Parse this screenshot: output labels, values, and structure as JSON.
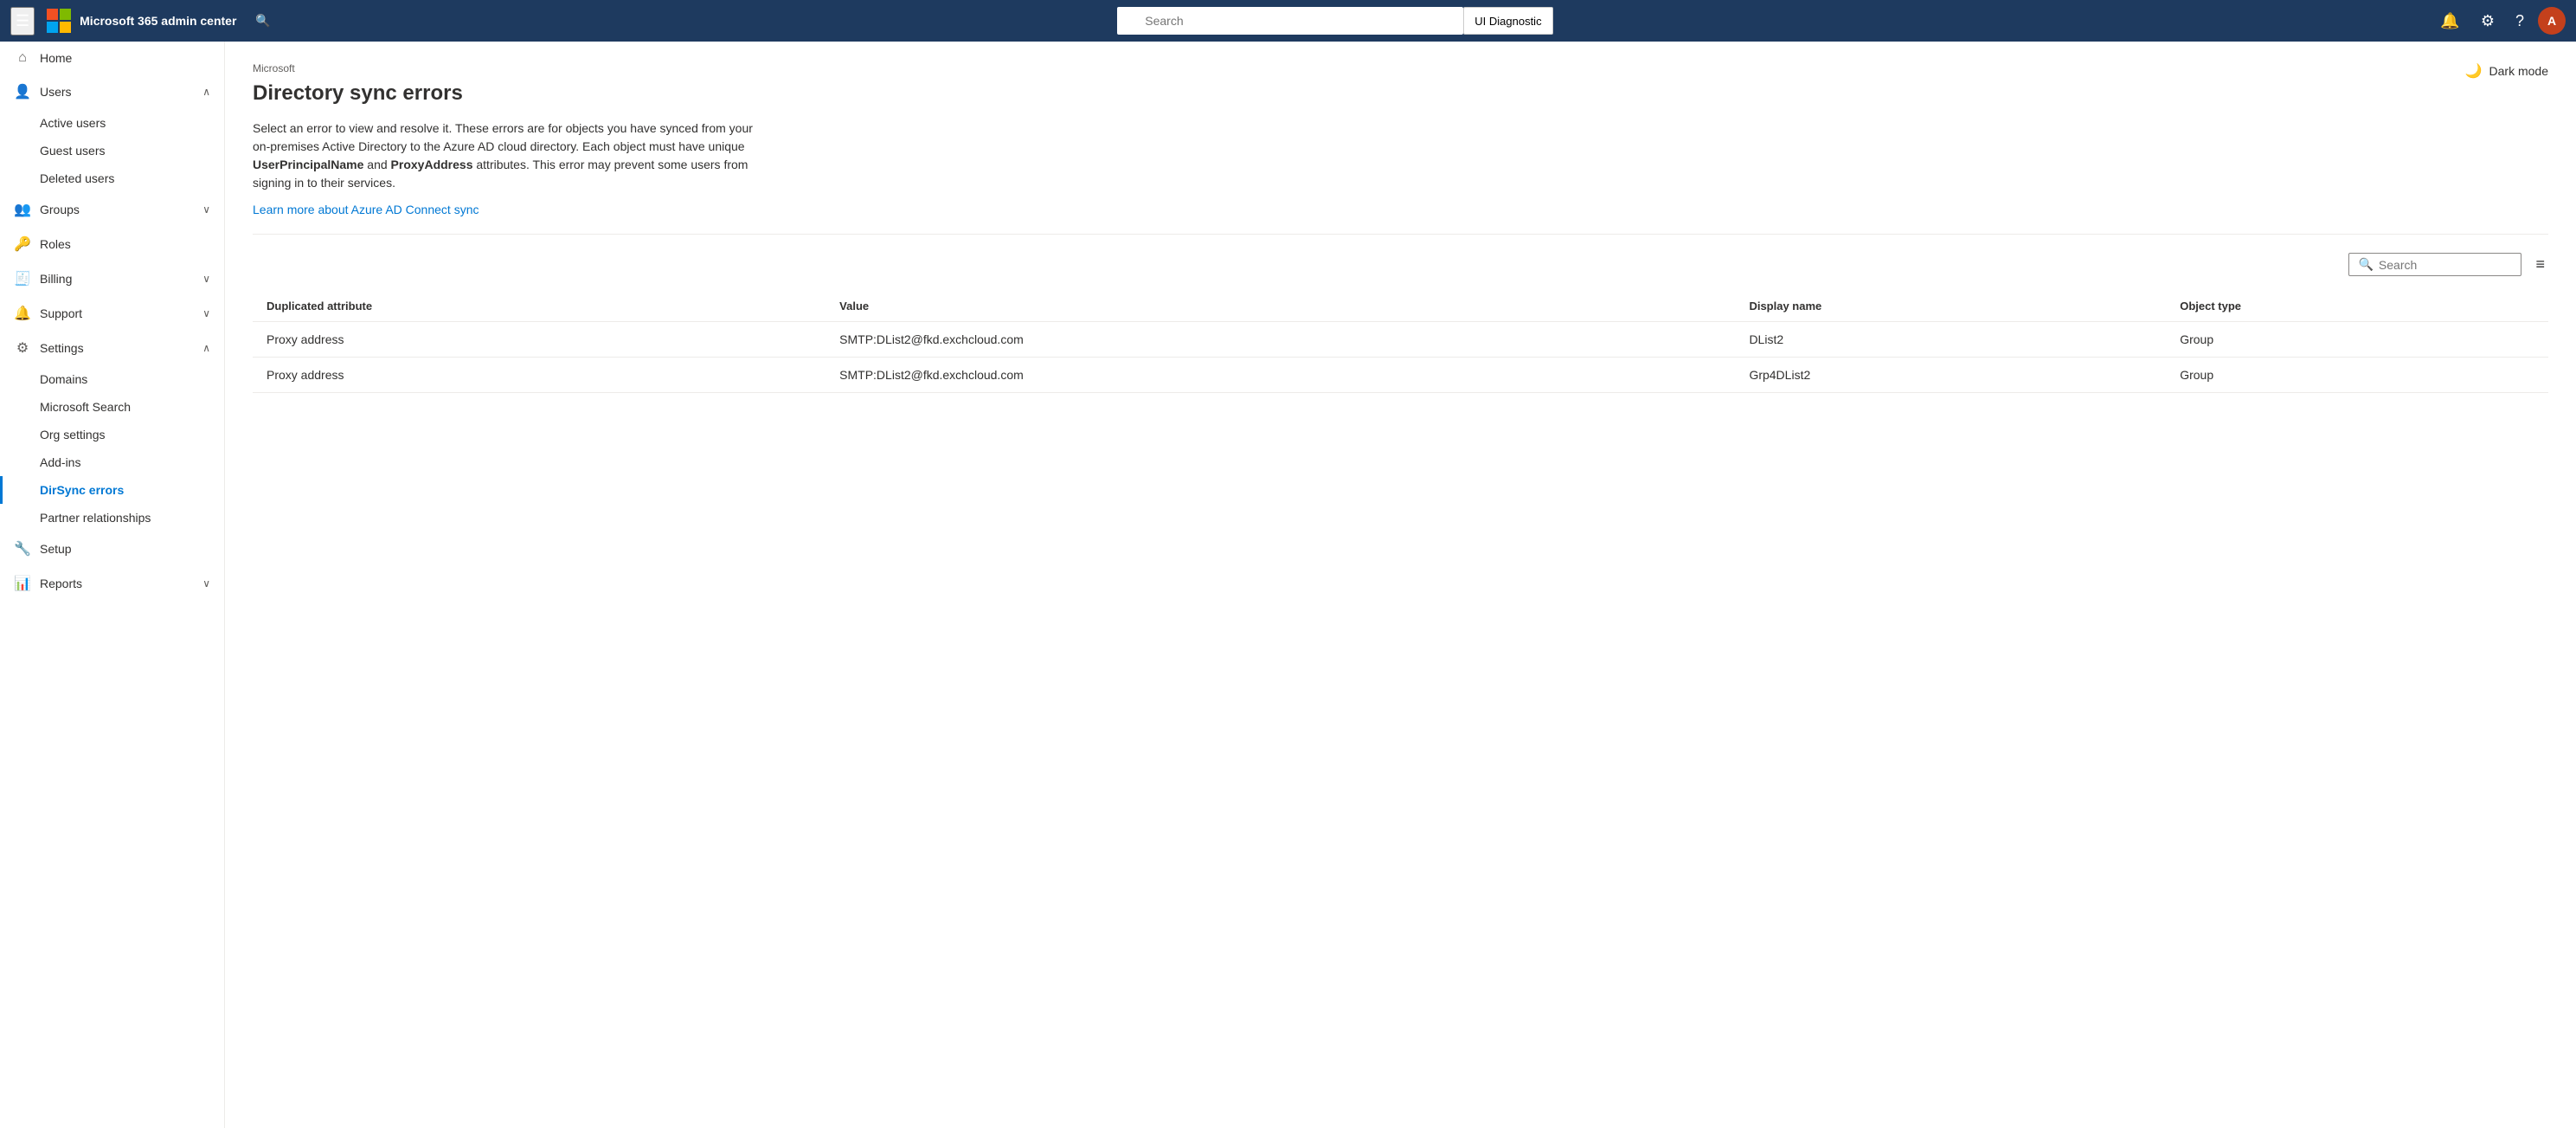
{
  "topbar": {
    "title": "Microsoft 365 admin center",
    "search_placeholder": "Search",
    "ui_diagnostic": "UI Diagnostic",
    "avatar_initials": "A"
  },
  "sidebar": {
    "hamburger_label": "☰",
    "items": [
      {
        "id": "home",
        "label": "Home",
        "icon": "⌂",
        "hasChildren": false
      },
      {
        "id": "users",
        "label": "Users",
        "icon": "👤",
        "hasChildren": true,
        "expanded": true
      },
      {
        "id": "groups",
        "label": "Groups",
        "icon": "👥",
        "hasChildren": true,
        "expanded": false
      },
      {
        "id": "roles",
        "label": "Roles",
        "icon": "🔑",
        "hasChildren": false
      },
      {
        "id": "billing",
        "label": "Billing",
        "icon": "🧾",
        "hasChildren": true,
        "expanded": false
      },
      {
        "id": "support",
        "label": "Support",
        "icon": "🔔",
        "hasChildren": true,
        "expanded": false
      },
      {
        "id": "settings",
        "label": "Settings",
        "icon": "⚙",
        "hasChildren": true,
        "expanded": true
      },
      {
        "id": "setup",
        "label": "Setup",
        "icon": "🔧",
        "hasChildren": false
      },
      {
        "id": "reports",
        "label": "Reports",
        "icon": "📊",
        "hasChildren": true,
        "expanded": false
      }
    ],
    "users_children": [
      {
        "id": "active-users",
        "label": "Active users"
      },
      {
        "id": "guest-users",
        "label": "Guest users"
      },
      {
        "id": "deleted-users",
        "label": "Deleted users"
      }
    ],
    "settings_children": [
      {
        "id": "domains",
        "label": "Domains"
      },
      {
        "id": "microsoft-search",
        "label": "Microsoft Search"
      },
      {
        "id": "org-settings",
        "label": "Org settings"
      },
      {
        "id": "add-ins",
        "label": "Add-ins"
      },
      {
        "id": "dirsync-errors",
        "label": "DirSync errors",
        "active": true
      },
      {
        "id": "partner-relationships",
        "label": "Partner relationships"
      }
    ]
  },
  "main": {
    "brand": "Microsoft",
    "title": "Directory sync errors",
    "description_1": "Select an error to view and resolve it. These errors are for objects you have synced from your on-premises Active Directory to the Azure AD cloud directory. Each object must have unique ",
    "description_bold_1": "UserPrincipalName",
    "description_2": " and ",
    "description_bold_2": "ProxyAddress",
    "description_3": " attributes. This error may prevent some users from signing in to their services.",
    "learn_more_link": "Learn more about Azure AD Connect sync",
    "dark_mode_label": "Dark mode",
    "search_placeholder": "Search",
    "table": {
      "columns": [
        {
          "id": "duplicated_attribute",
          "label": "Duplicated attribute"
        },
        {
          "id": "value",
          "label": "Value"
        },
        {
          "id": "display_name",
          "label": "Display name"
        },
        {
          "id": "object_type",
          "label": "Object type"
        }
      ],
      "rows": [
        {
          "duplicated_attribute": "Proxy address",
          "value": "SMTP:DList2@fkd.exchcloud.com",
          "display_name": "DList2",
          "object_type": "Group"
        },
        {
          "duplicated_attribute": "Proxy address",
          "value": "SMTP:DList2@fkd.exchcloud.com",
          "display_name": "Grp4DList2",
          "object_type": "Group"
        }
      ]
    }
  }
}
